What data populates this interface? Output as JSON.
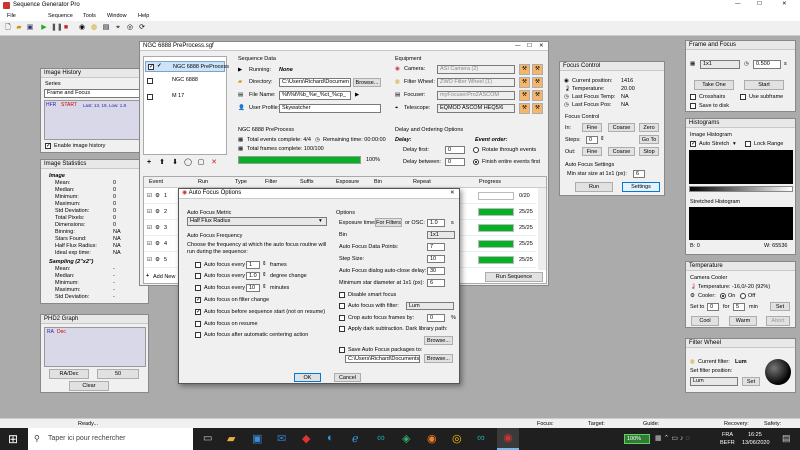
{
  "app": {
    "title": "Sequence Generator Pro",
    "menu": [
      "File",
      "Sequence",
      "Tools",
      "Window",
      "Help"
    ]
  },
  "img_history": {
    "title": "Image History",
    "series": "Series",
    "frame_focus": "Frame and Focus",
    "hfr": "HFR",
    "start": "START",
    "last": "Last: 13, 19, Low: 1.8",
    "enable": "Enable image history"
  },
  "img_stats": {
    "title": "Image Statistics",
    "image": "Image",
    "rows": [
      [
        "Mean:",
        "0"
      ],
      [
        "Median:",
        "0"
      ],
      [
        "Minimum:",
        "0"
      ],
      [
        "Maximum:",
        "0"
      ],
      [
        "Std Deviation:",
        "0"
      ],
      [
        "Total Pixels:",
        "0"
      ],
      [
        "Dimensions:",
        "0"
      ],
      [
        "Binning:",
        "NA"
      ],
      [
        "Stars Found:",
        "NA"
      ],
      [
        "Half Flux Radius:",
        "NA"
      ],
      [
        "Ideal exp time:",
        "NA"
      ]
    ],
    "sampling": "Sampling (2\"x2\")",
    "rows2": [
      [
        "Mean:",
        "-"
      ],
      [
        "Median:",
        "-"
      ],
      [
        "Minimum:",
        "-"
      ],
      [
        "Maximum:",
        "-"
      ],
      [
        "Std Deviation:",
        "-"
      ]
    ]
  },
  "phd2": {
    "title": "PHD2 Graph",
    "ra": "RA",
    "dec": "Dec",
    "radec": "RA/Dec",
    "scale": "50",
    "clear": "Clear"
  },
  "seq": {
    "title": "NGC 6888 PreProcess.sgf",
    "targets": [
      "NGC 6888 PreProcess",
      "NGC 6888",
      "M 17"
    ],
    "data_h": "Sequence Data",
    "running_l": "Running:",
    "running": "None",
    "dir_l": "Directory:",
    "dir": "C:\\Users\\Richard\\Documen",
    "fname_l": "File Name:",
    "fname": "%f\\%t\\%b_%e_%ct_%cp_",
    "profile_l": "User Profile:",
    "profile": "Skywatcher",
    "browse": "Browse...",
    "sub_h": "NGC 6888 PreProcess",
    "total_ev": "Total events complete: 4/4",
    "remain": "Remaining time: 00:00:00",
    "total_fr": "Total frames complete: 100/100",
    "pct": "100%",
    "equip_h": "Equipment",
    "cam_l": "Camera:",
    "cam": "ASI Camera (2)",
    "fw_l": "Filter Wheel:",
    "fw": "ZWO Filter Wheel (1)",
    "foc_l": "Focuser:",
    "foc": "myFocuserPro2ASCOM",
    "tel_l": "Telescope:",
    "tel": "EQMOD ASCOM HEQ5/6",
    "delay_h": "Delay and Ordering Options",
    "delay": "Delay:",
    "first": "Delay first:",
    "between": "Delay between:",
    "ev_order": "Event order:",
    "rotate": "Rotate through events",
    "finish": "Finish entire events first",
    "cols": [
      "Event",
      "Run",
      "Type",
      "Filter",
      "Suffix",
      "Exposure",
      "Bin",
      "Repeat",
      "Progress"
    ],
    "progress": [
      "0/20",
      "25/25",
      "25/25",
      "25/25",
      "25/25"
    ],
    "add": "Add New",
    "run_seq": "Run Sequence",
    "zero": "0"
  },
  "af": {
    "title": "Auto Focus Options",
    "metric_h": "Auto Focus Metric",
    "metric": "Half Flux Radius",
    "freq_h": "Auto Focus Frequency",
    "freq_desc": "Choose the frequency at which the auto focus routine will run during the sequence:",
    "every1": "Auto focus every",
    "frames": "frames",
    "v1": "1",
    "deg": "degree change",
    "v2": "1.0",
    "minutes": "minutes",
    "v3": "10",
    "filt": "Auto focus on filter change",
    "before": "Auto focus before sequence start (not on resume)",
    "resume": "Auto focus on resume",
    "meridian": "Auto focus after automatic centering action",
    "opt_h": "Options",
    "exp_l": "Exposure times:",
    "for_filters": "For Filters",
    "or_osc": "or OSC:",
    "exp": "1.0",
    "s": "s",
    "bin_l": "Bin",
    "bin": "1x1",
    "pts_l": "Auto Focus Data Points:",
    "pts": "7",
    "step_l": "Step Size:",
    "step": "10",
    "close_l": "Auto Focus dialog auto-close delay:",
    "close": "30",
    "min_l": "Minimum star diameter at 1x1 (px):",
    "min": "6",
    "smart": "Disable smart focus",
    "with_filt": "Auto focus with filter:",
    "lum": "Lum",
    "crop": "Crop auto focus frames by:",
    "crop_v": "0",
    "pct": "%",
    "dark": "Apply dark subtraction.  Dark library path:",
    "save": "Save Auto Focus packages to:",
    "save_path": "C:\\Users\\Richard\\Documents",
    "browse": "Browse...",
    "ok": "OK",
    "cancel": "Cancel"
  },
  "fc": {
    "title": "Focus Control",
    "pos_l": "Current position:",
    "pos": "1416",
    "temp_l": "Temperature:",
    "temp": "20.00",
    "laft_l": "Last Focus Temp:",
    "laft": "NA",
    "lafp_l": "Last Focus Pos:",
    "lafp": "NA",
    "ctrl": "Focus Control",
    "in": "In:",
    "out": "Out:",
    "fine": "Fine",
    "coarse": "Coarse",
    "zero": "Zero",
    "steps": "Steps:",
    "steps_v": "0",
    "goto": "Go To",
    "stop": "Stop",
    "settings_h": "Auto Focus Settings",
    "min": "Min star size at 1x1 (px):",
    "min_v": "6",
    "run": "Run",
    "settings": "Settings"
  },
  "ff": {
    "title": "Frame and Focus",
    "bin": "1x1",
    "exp": "0.500",
    "s": "s",
    "take": "Take One",
    "start": "Start",
    "crosshairs": "Crosshairs",
    "subframe": "Use subframe",
    "save": "Save to disk"
  },
  "hist": {
    "title": "Histograms",
    "ih": "Image Histogram",
    "stretch": "Auto Stretch",
    "lock": "Lock Range",
    "sh": "Stretched Histogram",
    "b": "B: 0",
    "w": "W: 65536"
  },
  "temp": {
    "title": "Temperature",
    "cc": "Camera Cooler",
    "t": "Temperature: -16,0/-20 (92%)",
    "cooler": "Cooler:",
    "on": "On",
    "off": "Off",
    "set": "Set to",
    "setv": "0",
    "for": "for",
    "forv": "5",
    "min": "min",
    "set_btn": "Set",
    "cool": "Cool",
    "warm": "Warm",
    "abort": "Abort"
  },
  "fwp": {
    "title": "Filter Wheel",
    "cur_l": "Current filter:",
    "cur": "Lum",
    "set_l": "Set filter position:",
    "set": "Set"
  },
  "status": {
    "ready": "Ready...",
    "focus": "Focus:",
    "target": "Target:",
    "guide": "Guide:",
    "recovery": "Recovery:",
    "safety": "Safety:"
  },
  "taskbar": {
    "search": "Taper ici pour rechercher",
    "battery": "100%",
    "lang1": "FRA",
    "lang2": "BEFR",
    "time": "16:25",
    "date": "13/06/2020"
  }
}
